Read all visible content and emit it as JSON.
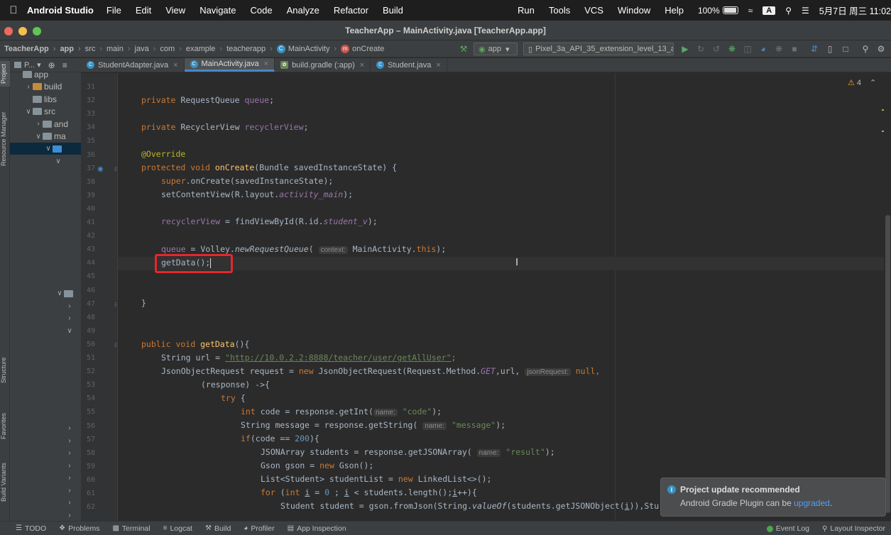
{
  "menubar": {
    "app_name": "Android Studio",
    "items": [
      "File",
      "Edit",
      "View",
      "Navigate",
      "Code",
      "Analyze",
      "Refactor",
      "Build"
    ],
    "right_items": [
      "Run",
      "Tools",
      "VCS",
      "Window",
      "Help"
    ],
    "battery": "100%",
    "input": "A",
    "datetime": "5月7日 周三 11:02"
  },
  "window": {
    "title": "TeacherApp – MainActivity.java [TeacherApp.app]"
  },
  "breadcrumb": [
    "TeacherApp",
    "app",
    "src",
    "main",
    "java",
    "com",
    "example",
    "teacherapp",
    "MainActivity",
    "onCreate"
  ],
  "toolbar": {
    "run_config": "app",
    "device": "Pixel_3a_API_35_extension_level_13_a..."
  },
  "project_panel": {
    "title": "P...",
    "tree": [
      {
        "label": "app",
        "indent": 1,
        "arrow": "",
        "folder": "grey"
      },
      {
        "label": "build",
        "indent": 2,
        "arrow": ">",
        "folder": "orange"
      },
      {
        "label": "libs",
        "indent": 2,
        "arrow": "",
        "folder": "grey"
      },
      {
        "label": "src",
        "indent": 2,
        "arrow": "v",
        "folder": "grey"
      },
      {
        "label": "and",
        "indent": 3,
        "arrow": ">",
        "folder": "grey"
      },
      {
        "label": "ma",
        "indent": 3,
        "arrow": "v",
        "folder": "grey"
      },
      {
        "label": "",
        "indent": 4,
        "arrow": "v",
        "folder": "blue"
      },
      {
        "label": "",
        "indent": 5,
        "arrow": "v",
        "folder": "none"
      }
    ],
    "lower_rows": [
      {
        "arrow": "v",
        "folder": true
      },
      {
        "arrow": ">",
        "folder": false
      },
      {
        "arrow": ">",
        "folder": false
      },
      {
        "arrow": "v",
        "folder": false
      }
    ],
    "bottom_rows": [
      ">",
      ">",
      ">",
      ">",
      ">",
      ">",
      ">",
      ">"
    ]
  },
  "left_stripe": [
    "Project",
    "Resource Manager",
    "Structure",
    "Favorites",
    "Build Variants"
  ],
  "tabs": [
    {
      "label": "StudentAdapter.java",
      "icon": "C",
      "active": false
    },
    {
      "label": "MainActivity.java",
      "icon": "C",
      "active": true
    },
    {
      "label": "build.gradle (:app)",
      "icon": "gradle",
      "active": false
    },
    {
      "label": "Student.java",
      "icon": "C",
      "active": false
    }
  ],
  "editor": {
    "warnings": "4",
    "line_numbers": [
      "31",
      "32",
      "33",
      "34",
      "35",
      "36",
      "37",
      "38",
      "39",
      "40",
      "41",
      "42",
      "43",
      "44",
      "45",
      "46",
      "47",
      "48",
      "49",
      "50",
      "51",
      "52",
      "53",
      "54",
      "55",
      "56",
      "57",
      "58",
      "59",
      "60",
      "61",
      "62"
    ],
    "code": {
      "l32": [
        "private",
        "RequestQueue",
        "queue"
      ],
      "l34": [
        "private",
        "RecyclerView",
        "recyclerView"
      ],
      "l36": "@Override",
      "l37": [
        "protected void",
        "onCreate",
        "(Bundle savedInstanceState) {"
      ],
      "l38": [
        "super",
        ".onCreate(savedInstanceState);"
      ],
      "l39": [
        "setContentView(R.layout.",
        "activity_main",
        ");"
      ],
      "l41": [
        "recyclerView",
        " = findViewById(R.id.",
        "student_v",
        ");"
      ],
      "l43": [
        "queue",
        " = Volley.",
        "newRequestQueue",
        "(",
        "context:",
        " MainActivity.",
        "this",
        ");"
      ],
      "l44": "getData();",
      "l47": "}",
      "l50": [
        "public void",
        "getData",
        "(){"
      ],
      "l51": [
        "String url = ",
        "\"http://10.0.2.2:8888/teacher/user/getAllUser\"",
        ";"
      ],
      "l52": [
        "JsonObjectRequest request = ",
        "new",
        " JsonObjectRequest(Request.Method.",
        "GET",
        ",url,",
        "jsonRequest:",
        "null",
        ","
      ],
      "l53": "(response) ->{",
      "l54": [
        "try",
        " {"
      ],
      "l55": [
        "int",
        " code = response.getInt(",
        "name:",
        "\"code\"",
        ");"
      ],
      "l56": [
        "String message = response.getString(",
        "name:",
        "\"message\"",
        ");"
      ],
      "l57": [
        "if",
        "(code == ",
        "200",
        "){"
      ],
      "l58": [
        "JSONArray students = response.getJSONArray(",
        "name:",
        "\"result\"",
        ");"
      ],
      "l59": [
        "Gson gson = ",
        "new",
        " Gson();"
      ],
      "l60": [
        "List<Student> studentList = ",
        "new",
        " LinkedList<>();"
      ],
      "l61": [
        "for",
        " (",
        "int",
        " ",
        "i",
        " = ",
        "0",
        " ; ",
        "i",
        " < students.length();",
        "i",
        "++){"
      ],
      "l62": [
        "Student student = gson.fromJson(String.",
        "valueOf",
        "(students.getJSONObject(",
        "i",
        ")),Stu"
      ]
    }
  },
  "notification": {
    "title": "Project update recommended",
    "body_prefix": "Android Gradle Plugin can be ",
    "link": "upgraded",
    "body_suffix": "."
  },
  "bottombar": {
    "left": [
      "TODO",
      "Problems",
      "Terminal",
      "Logcat",
      "Build",
      "Profiler",
      "App Inspection"
    ],
    "right": [
      "Event Log",
      "Layout Inspector"
    ]
  },
  "colors": {
    "accent": "#4a88c7",
    "highlight_box": "#e8262b",
    "keyword": "#cc7832",
    "field": "#9876aa",
    "string": "#6a8759"
  }
}
